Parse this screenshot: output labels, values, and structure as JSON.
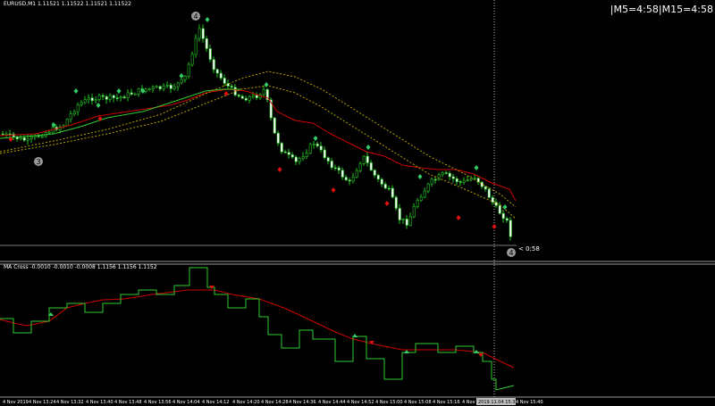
{
  "symbol_info": "EURUSD,M1  1.11521 1.11522 1.11521 1.11522",
  "timer": "|M5=4:58|M15=4:58",
  "indicator_info": "MA Cross -0.0010 -0.0010 -0.0008  1.1156 1.1156 1.1152",
  "price_tag": "< 0:58",
  "wave_labels": [
    "4",
    "3",
    "4"
  ],
  "colors": {
    "background": "#000000",
    "candle": "#22c322",
    "fast_ma": "#32cd32",
    "slow_ma": "#cc0000",
    "envelope": "#b8a400",
    "buy_arrow": "#33cc66",
    "sell_arrow": "#e01010",
    "grid": "#bbbbbb"
  },
  "time_axis": [
    "4 Nov 2019",
    "4 Nov 13:24",
    "4 Nov 13:32",
    "4 Nov 13:40",
    "4 Nov 13:48",
    "4 Nov 13:56",
    "4 Nov 14:04",
    "4 Nov 14:12",
    "4 Nov 14:20",
    "4 Nov 14:28",
    "4 Nov 14:36",
    "4 Nov 14:44",
    "4 Nov 14:52",
    "4 Nov 15:00",
    "4 Nov 15:08",
    "4 Nov 15:16",
    "4 Nov 15:24",
    "2019.11.04 15:34",
    "4 Nov 15:40"
  ]
}
